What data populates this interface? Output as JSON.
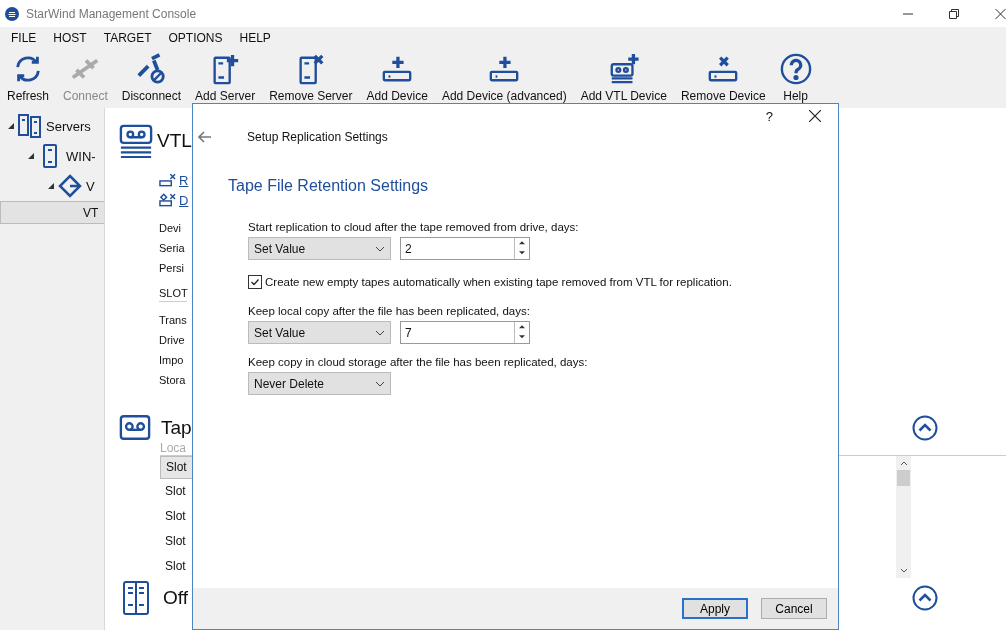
{
  "window": {
    "title": "StarWind Management Console"
  },
  "menu": [
    "FILE",
    "HOST",
    "TARGET",
    "OPTIONS",
    "HELP"
  ],
  "toolbar": [
    {
      "label": "Refresh",
      "kind": "refresh",
      "disabled": false
    },
    {
      "label": "Connect",
      "kind": "connect",
      "disabled": true
    },
    {
      "label": "Disconnect",
      "kind": "disconnect",
      "disabled": false
    },
    {
      "label": "Add Server",
      "kind": "add-server",
      "disabled": false
    },
    {
      "label": "Remove Server",
      "kind": "remove-server",
      "disabled": false
    },
    {
      "label": "Add Device",
      "kind": "add-device",
      "disabled": false
    },
    {
      "label": "Add Device (advanced)",
      "kind": "add-device",
      "disabled": false
    },
    {
      "label": "Add VTL Device",
      "kind": "add-vtl",
      "disabled": false
    },
    {
      "label": "Remove Device",
      "kind": "remove-device",
      "disabled": false
    },
    {
      "label": "Help",
      "kind": "help",
      "disabled": false
    }
  ],
  "tree": [
    {
      "label": "Servers",
      "kind": "servers",
      "expanded": true,
      "selected": false,
      "children": [
        {
          "label": "WIN-",
          "kind": "server",
          "expanded": true,
          "selected": false,
          "children": [
            {
              "label": "V",
              "kind": "target",
              "expanded": true,
              "selected": false,
              "children": [
                {
                  "label": "VT",
                  "selected": true
                }
              ]
            }
          ]
        }
      ]
    }
  ],
  "content": {
    "vtl": {
      "title": "VTL",
      "links": [
        {
          "label": "R",
          "kind": "remove"
        },
        {
          "label": "D",
          "kind": "disconnect"
        }
      ],
      "fields": [
        "Devi",
        "Seria",
        "Persi"
      ],
      "slots_header": "SLOT",
      "slots": [
        "Trans",
        "Drive",
        "Impo",
        "Stora"
      ]
    },
    "tapes": {
      "title": "Tap",
      "subtitle": "Loca",
      "rows": [
        {
          "label": "Slot",
          "selected": true
        },
        {
          "label": "Slot",
          "selected": false
        },
        {
          "label": "Slot",
          "selected": false
        },
        {
          "label": "Slot",
          "selected": false
        },
        {
          "label": "Slot",
          "selected": false
        }
      ]
    },
    "offsite": {
      "title": "Off"
    }
  },
  "dialog": {
    "title": "Setup Replication Settings",
    "help": "?",
    "heading": "Tape File Retention Settings",
    "settings": [
      {
        "kind": "select_spin",
        "label": "Start replication to cloud after the tape removed from drive, days:",
        "select": "Set Value",
        "value": "2"
      },
      {
        "kind": "checkbox",
        "label": "Create new empty tapes automatically when existing tape removed from VTL for replication.",
        "checked": true
      },
      {
        "kind": "select_spin",
        "label": "Keep local copy after the file has been replicated, days:",
        "select": "Set Value",
        "value": "7"
      },
      {
        "kind": "select",
        "label": "Keep copy in cloud storage after the file has been replicated, days:",
        "select": "Never Delete"
      }
    ],
    "buttons": [
      {
        "label": "Apply",
        "default": true
      },
      {
        "label": "Cancel",
        "default": false
      }
    ]
  }
}
